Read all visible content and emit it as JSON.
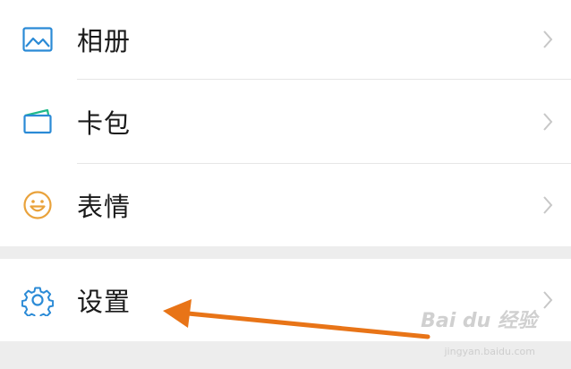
{
  "menu": {
    "items": [
      {
        "label": "相册",
        "icon": "photo-album-icon"
      },
      {
        "label": "卡包",
        "icon": "card-wallet-icon"
      },
      {
        "label": "表情",
        "icon": "smiley-face-icon"
      },
      {
        "label": "设置",
        "icon": "gear-icon"
      }
    ]
  },
  "colors": {
    "icon_blue": "#2a8ad6",
    "icon_green": "#1fba8a",
    "icon_orange": "#e9a23b",
    "arrow": "#e87417"
  },
  "watermark": {
    "brand": "Bai du 经验",
    "url": "jingyan.baidu.com"
  }
}
